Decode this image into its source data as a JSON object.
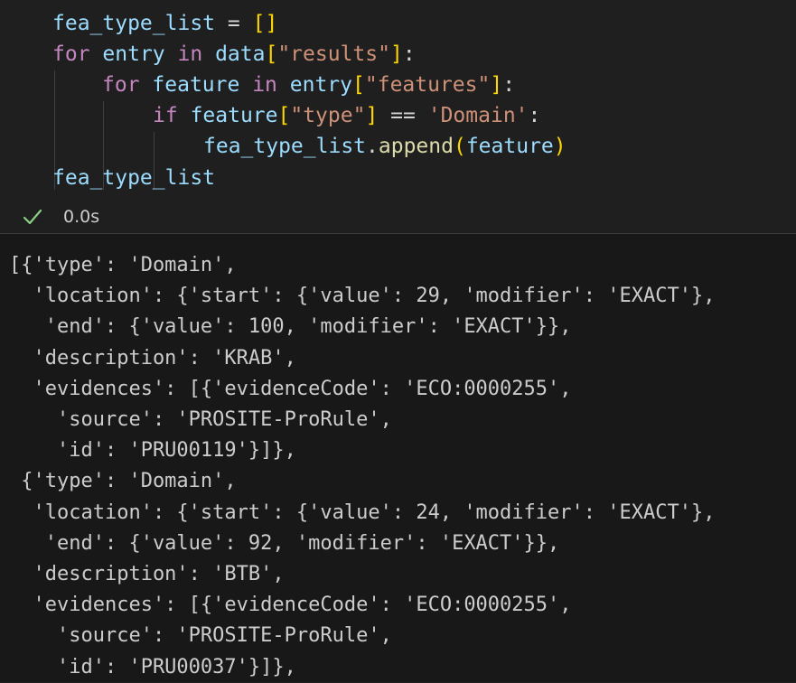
{
  "code_cell": {
    "lines": [
      "fea_type_list = []",
      "for entry in data[\"results\"]:",
      "for feature in entry[\"features\"]:",
      "if feature[\"type\"] == 'Domain':",
      "fea_type_list.append(feature)",
      "fea_type_list"
    ]
  },
  "execution": {
    "status_icon": "check-icon",
    "time": "0.0s",
    "status_color": "#89d185"
  },
  "output": {
    "lines": [
      "[{'type': 'Domain',",
      "  'location': {'start': {'value': 29, 'modifier': 'EXACT'},",
      "   'end': {'value': 100, 'modifier': 'EXACT'}},",
      "  'description': 'KRAB',",
      "  'evidences': [{'evidenceCode': 'ECO:0000255',",
      "    'source': 'PROSITE-ProRule',",
      "    'id': 'PRU00119'}]},",
      " {'type': 'Domain',",
      "  'location': {'start': {'value': 24, 'modifier': 'EXACT'},",
      "   'end': {'value': 92, 'modifier': 'EXACT'}},",
      "  'description': 'BTB',",
      "  'evidences': [{'evidenceCode': 'ECO:0000255',",
      "    'source': 'PROSITE-ProRule',",
      "    'id': 'PRU00037'}]},"
    ]
  }
}
